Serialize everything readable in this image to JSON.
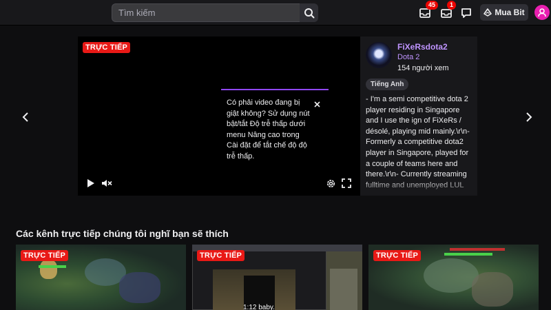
{
  "topbar": {
    "search": {
      "placeholder": "Tìm kiếm"
    },
    "notifications_count": "45",
    "messages_count": "1",
    "buy_bits_label": "Mua Bit"
  },
  "featured": {
    "live_label": "TRỰC TIẾP",
    "popup_text": "Có phải video đang bị giật không? Sử dụng nút bật/tắt Độ trễ thấp dưới menu Nâng cao trong Cài đặt để tắt chế độ độ trễ thấp.",
    "channel": {
      "name": "FiXeRsdota2",
      "game": "Dota 2",
      "viewers": "154 người xem",
      "tag": "Tiếng Anh",
      "description": "- I'm a semi competitive dota 2 player residing in Singapore and I use the ign of FiXeRs / désolé, playing mid mainly.\\r\\n- Formerly a competitive dota2 player in Singapore, played for a couple of teams here and there.\\r\\n- Currently streaming fulltime and unemployed LUL"
    }
  },
  "recommended": {
    "title": "Các kênh trực tiếp chúng tôi nghĩ bạn sẽ thích",
    "items": [
      {
        "live_label": "TRỰC TIẾP"
      },
      {
        "live_label": "TRỰC TIẾP",
        "caption": "1:12 baby."
      },
      {
        "live_label": "TRỰC TIẾP"
      }
    ]
  },
  "colors": {
    "accent": "#9147ff",
    "live": "#e91916",
    "avatar": "#e91fb0"
  },
  "icons": [
    "search-icon",
    "inbox-icon",
    "messages-icon",
    "whisper-icon",
    "bits-icon",
    "user-icon",
    "chevron-left-icon",
    "chevron-right-icon",
    "play-icon",
    "mute-icon",
    "settings-icon",
    "fullscreen-icon",
    "close-icon"
  ]
}
